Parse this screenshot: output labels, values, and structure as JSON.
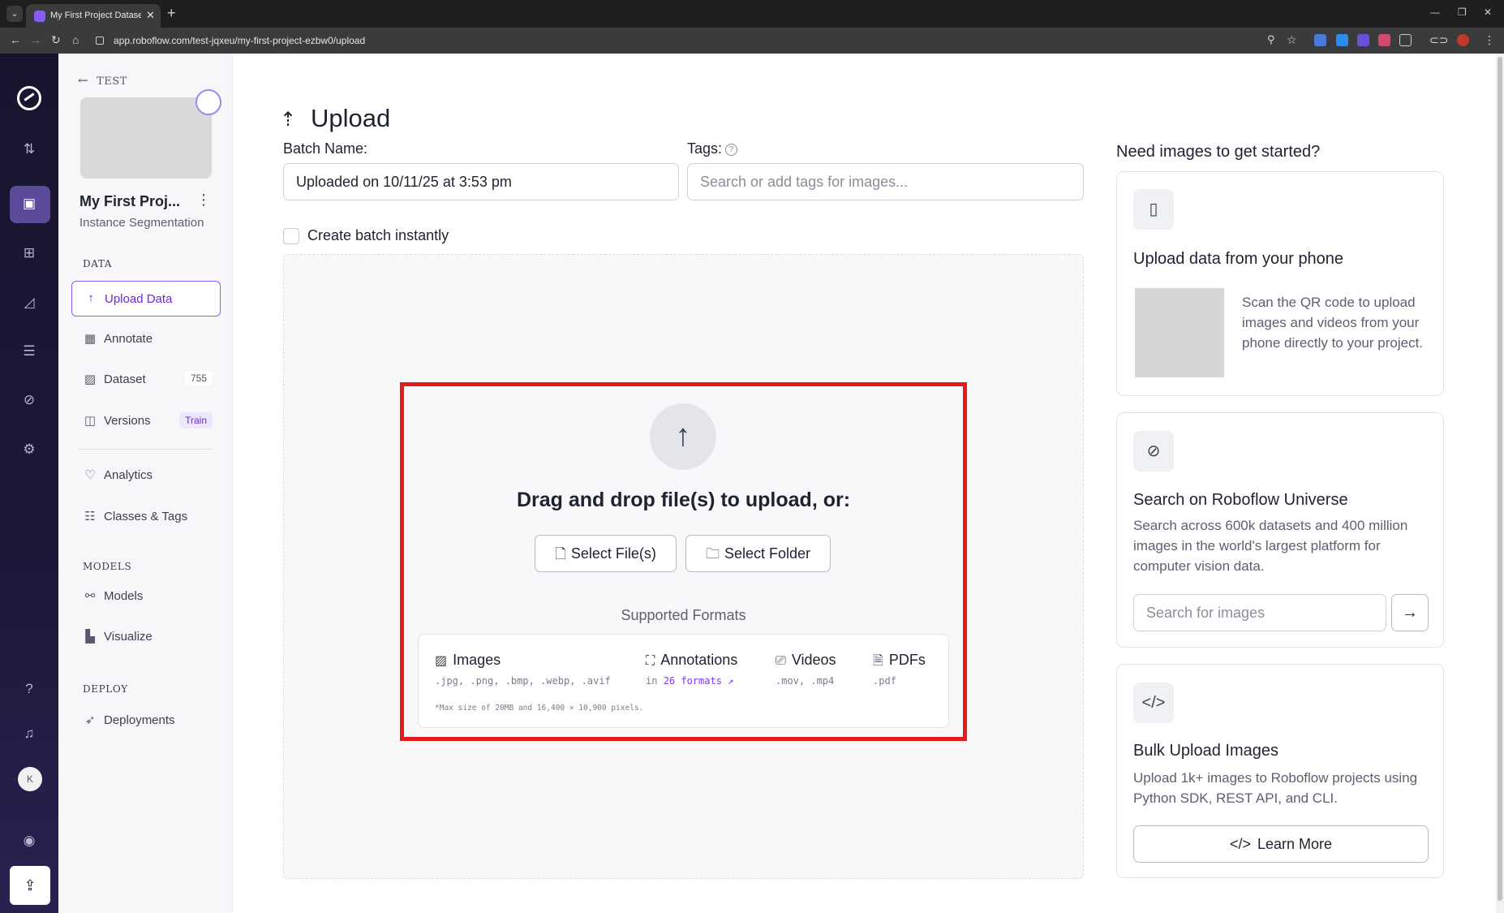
{
  "browser": {
    "tab_title": "My First Project Dataset > Up",
    "url": "app.roboflow.com/test-jqxeu/my-first-project-ezbw0/upload"
  },
  "rail": {
    "avatar_letter": "K"
  },
  "sidebar": {
    "back_label": "TEST",
    "project_name": "My First Proj...",
    "project_type": "Instance Segmentation",
    "sections": {
      "data": "DATA",
      "models": "MODELS",
      "deploy": "DEPLOY"
    },
    "items": [
      {
        "label": "Upload Data",
        "icon": "upload-icon"
      },
      {
        "label": "Annotate",
        "icon": "annotate-icon"
      },
      {
        "label": "Dataset",
        "icon": "dataset-icon",
        "count": "755"
      },
      {
        "label": "Versions",
        "icon": "versions-icon",
        "badge": "Train"
      },
      {
        "label": "Analytics",
        "icon": "analytics-icon"
      },
      {
        "label": "Classes & Tags",
        "icon": "classes-icon"
      },
      {
        "label": "Models",
        "icon": "models-icon"
      },
      {
        "label": "Visualize",
        "icon": "visualize-icon"
      },
      {
        "label": "Deployments",
        "icon": "rocket-icon"
      }
    ]
  },
  "main": {
    "title": "Upload",
    "batch_label": "Batch Name:",
    "batch_value": "Uploaded on 10/11/25 at 3:53 pm",
    "tags_label": "Tags:",
    "tags_placeholder": "Search or add tags for images...",
    "create_batch_label": "Create batch instantly",
    "dropzone": {
      "title": "Drag and drop file(s) to upload, or:",
      "select_files": "Select File(s)",
      "select_folder": "Select Folder",
      "supported_label": "Supported Formats",
      "formats": [
        {
          "name": "Images",
          "ext": ".jpg, .png, .bmp, .webp, .avif"
        },
        {
          "name": "Annotations",
          "ext_prefix": "in",
          "ext_link": "26 formats ↗"
        },
        {
          "name": "Videos",
          "ext": ".mov, .mp4"
        },
        {
          "name": "PDFs",
          "ext": ".pdf"
        }
      ],
      "note": "*Max size of 20MB and 16,400 × 10,900 pixels."
    }
  },
  "right": {
    "heading": "Need images to get started?",
    "phone_card": {
      "title": "Upload data from your phone",
      "text": "Scan the QR code to upload images and videos from your phone directly to your project."
    },
    "universe_card": {
      "title": "Search on Roboflow Universe",
      "text": "Search across 600k datasets and 400 million images in the world's largest platform for computer vision data.",
      "search_placeholder": "Search for images"
    },
    "bulk_card": {
      "title": "Bulk Upload Images",
      "text": "Upload 1k+ images to Roboflow projects using Python SDK, REST API, and CLI.",
      "button": "Learn More"
    }
  },
  "colors": {
    "accent": "#7c3aed",
    "highlight": "#e31b1b",
    "rail": "#1d1839"
  }
}
